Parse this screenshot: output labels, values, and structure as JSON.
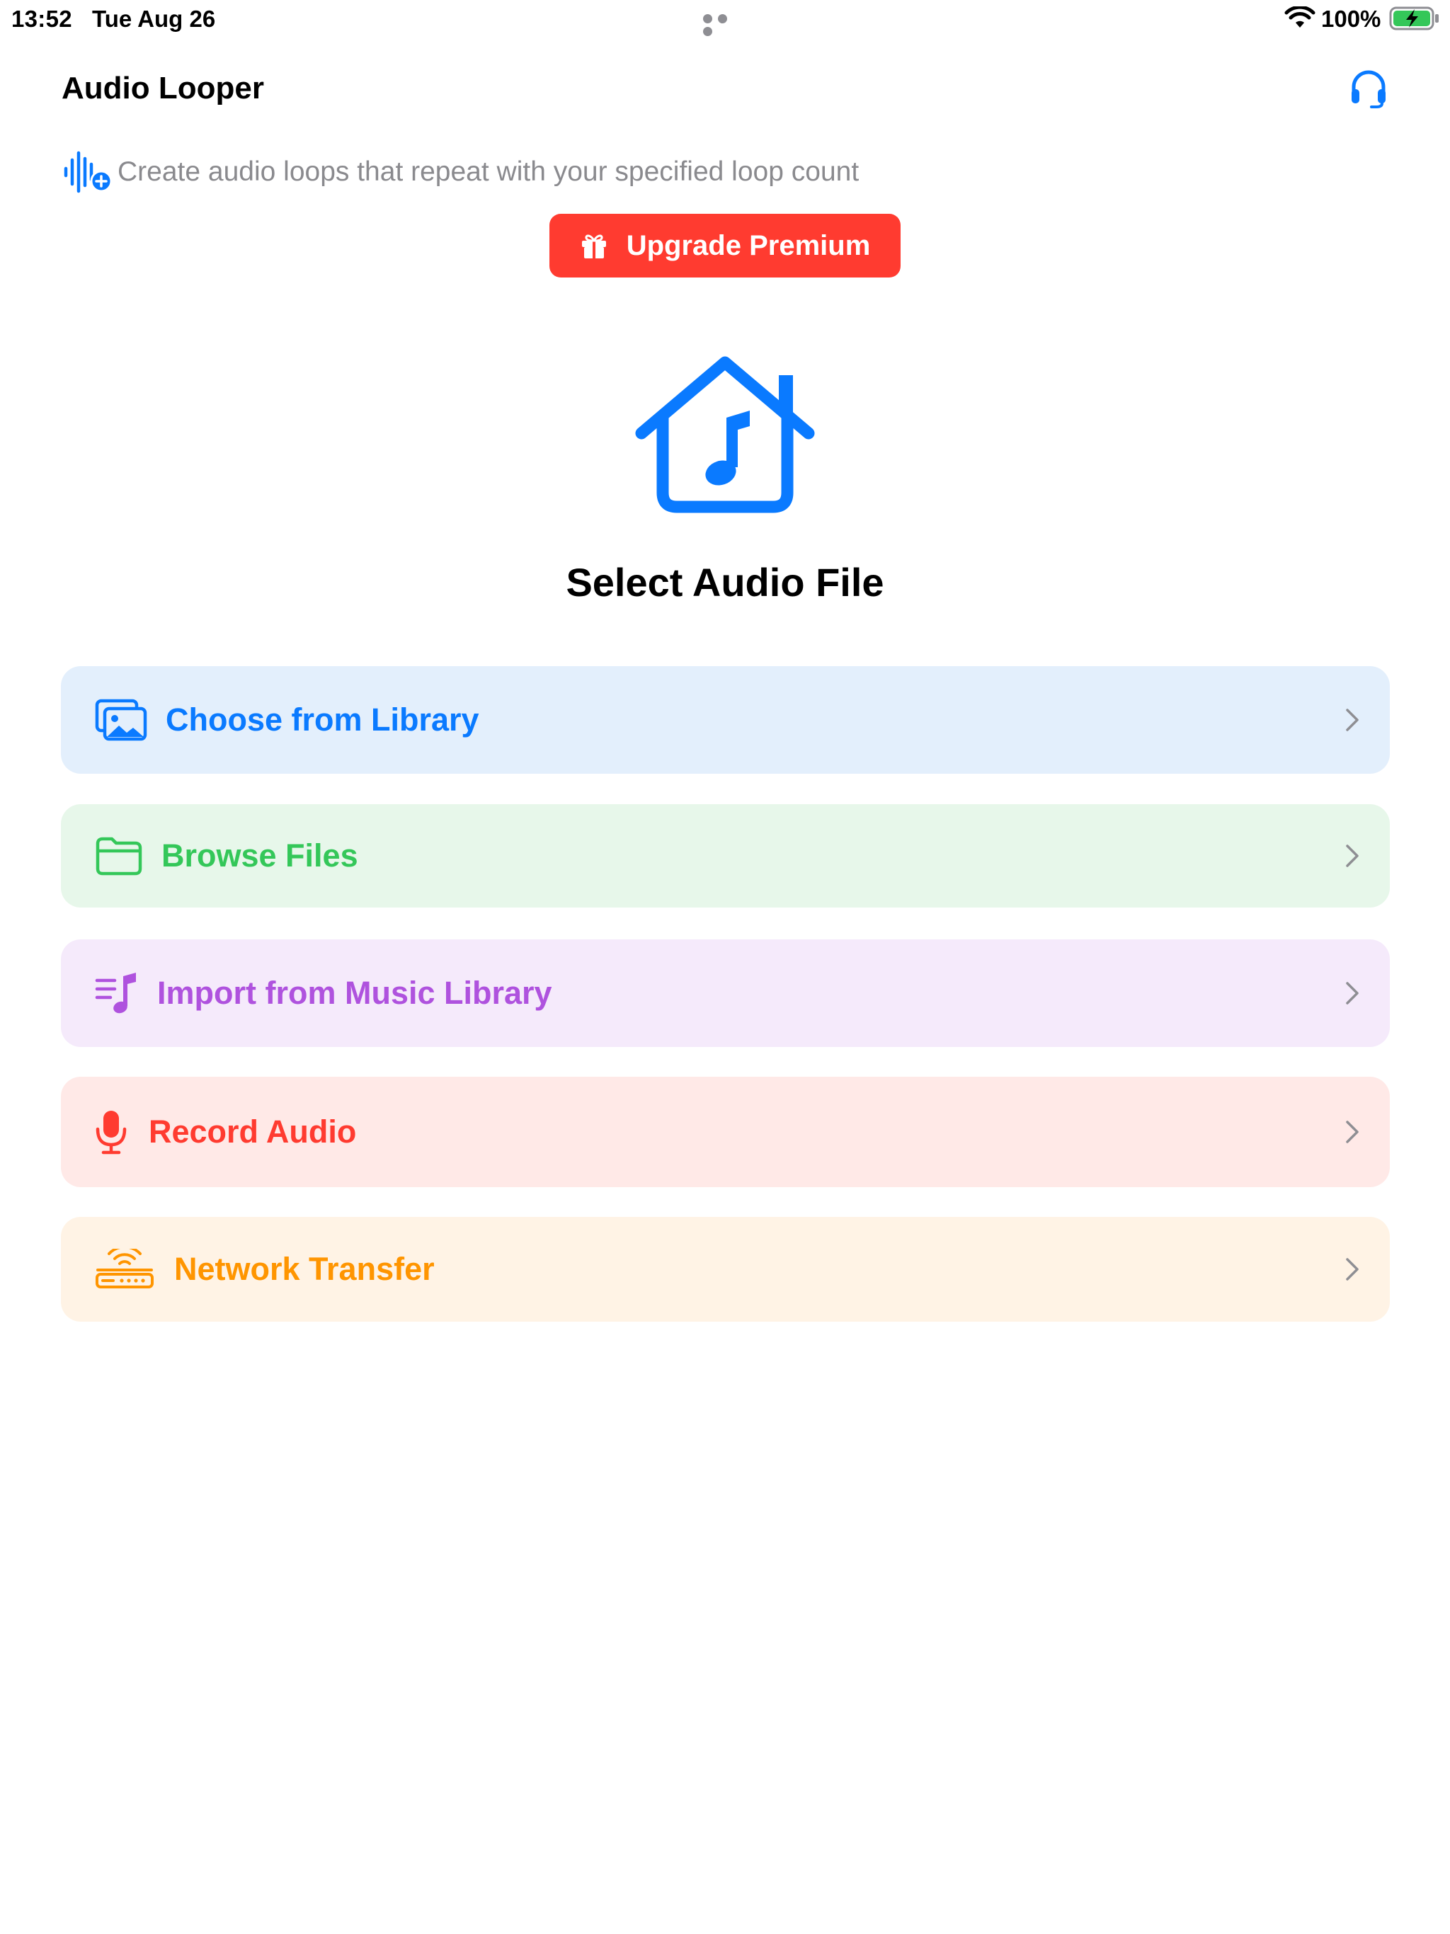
{
  "status_bar": {
    "time": "13:52",
    "date": "Tue Aug 26",
    "battery": "100%"
  },
  "nav": {
    "title": "Audio Looper",
    "support_icon": "headphones-icon"
  },
  "subtitle": {
    "icon": "waveform-badge-plus-icon",
    "text": "Create audio loops that repeat with your specified loop count"
  },
  "upgrade": {
    "icon": "gift-icon",
    "label": "Upgrade Premium"
  },
  "hero": {
    "icon": "house-music-note-icon",
    "title": "Select Audio File"
  },
  "options": [
    {
      "label": "Choose from Library",
      "icon": "photo-library-icon",
      "color": "#0a7aff",
      "background": "#e3effc"
    },
    {
      "label": "Browse Files",
      "icon": "folder-icon",
      "color": "#34c759",
      "background": "#e7f7ea"
    },
    {
      "label": "Import from Music Library",
      "icon": "music-list-icon",
      "color": "#af52de",
      "background": "#f5eafb"
    },
    {
      "label": "Record Audio",
      "icon": "microphone-icon",
      "color": "#ff3b30",
      "background": "#ffe9e7"
    },
    {
      "label": "Network Transfer",
      "icon": "router-icon",
      "color": "#ff9500",
      "background": "#fff3e5"
    }
  ],
  "colors": {
    "accent": "#0a7aff",
    "premium": "#ff3b30",
    "secondary_text": "#8a8a8e",
    "battery_green": "#34c759"
  }
}
